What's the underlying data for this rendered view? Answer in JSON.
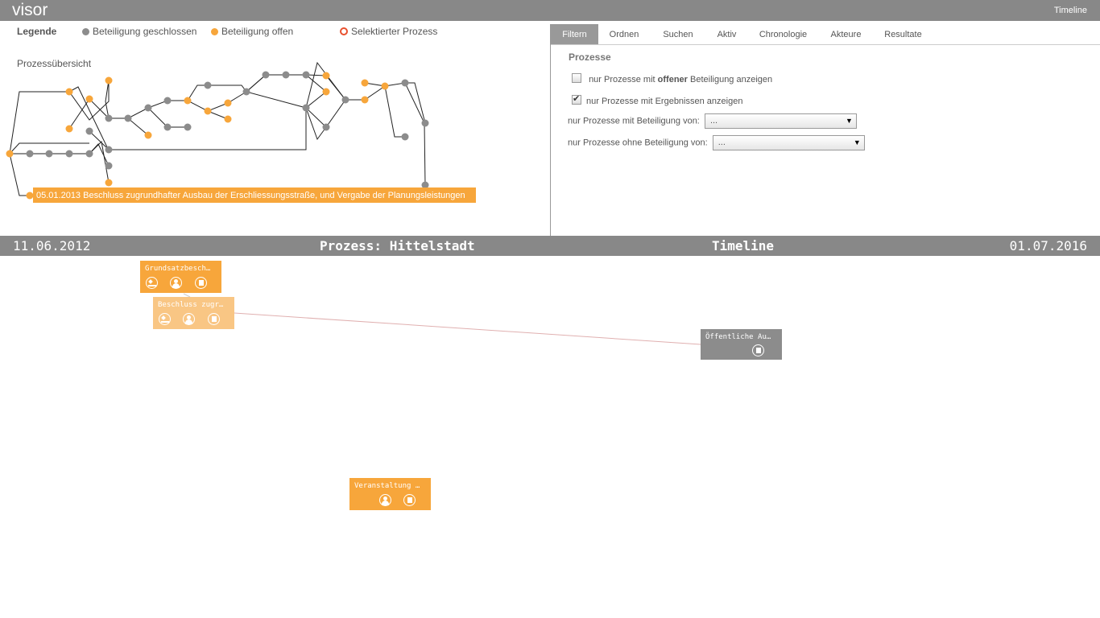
{
  "header": {
    "app_title": "visor",
    "nav_link": "Timeline"
  },
  "legend": {
    "title": "Legende",
    "items": [
      {
        "label": "Beteiligung geschlossen",
        "color": "#8c8c8c",
        "style": "filled"
      },
      {
        "label": "Beteiligung offen",
        "color": "#f7a63b",
        "style": "filled"
      },
      {
        "label": "Selektierter Prozess",
        "color": "#e8502e",
        "style": "ring"
      }
    ]
  },
  "overview": {
    "title": "Prozessübersicht",
    "tooltip": "05.01.2013 Beschluss zugrundhafter Ausbau der Erschliessungsstraße, und Vergabe der Planungsleistungen"
  },
  "tabs": [
    {
      "label": "Filtern",
      "active": true
    },
    {
      "label": "Ordnen",
      "active": false
    },
    {
      "label": "Suchen",
      "active": false
    },
    {
      "label": "Aktiv",
      "active": false
    },
    {
      "label": "Chronologie",
      "active": false
    },
    {
      "label": "Akteure",
      "active": false
    },
    {
      "label": "Resultate",
      "active": false
    }
  ],
  "filter": {
    "section_title": "Prozesse",
    "open_checkbox": {
      "prefix": "nur Prozesse mit ",
      "bold": "offener",
      "suffix": " Beteiligung anzeigen",
      "checked": false
    },
    "results_checkbox": {
      "label": "nur Prozesse mit Ergebnissen anzeigen",
      "checked": true
    },
    "with_participation": {
      "label": "nur Prozesse mit Beteiligung von:",
      "value": "..."
    },
    "without_participation": {
      "label": "nur Prozesse ohne Beteiligung von:",
      "value": "..."
    }
  },
  "timebar": {
    "start_date": "11.06.2012",
    "process_title": "Prozess: Hittelstadt",
    "mode": "Timeline",
    "end_date": "01.07.2016"
  },
  "timeline_cards": [
    {
      "title": "Grundsatzbesch…",
      "color": "#f7a63b",
      "icons": [
        "gavel-icon",
        "person-icon",
        "document-icon"
      ]
    },
    {
      "title": "Beschluss zugr…",
      "color": "#f9c684",
      "icons": [
        "gavel-icon",
        "person-icon",
        "document-icon"
      ]
    },
    {
      "title": "Öffentliche Au…",
      "color": "#8c8c8c",
      "icons": [
        "document-icon"
      ]
    },
    {
      "title": "Veranstaltung …",
      "color": "#f7a63b",
      "icons": [
        "person-icon",
        "document-icon"
      ]
    }
  ]
}
